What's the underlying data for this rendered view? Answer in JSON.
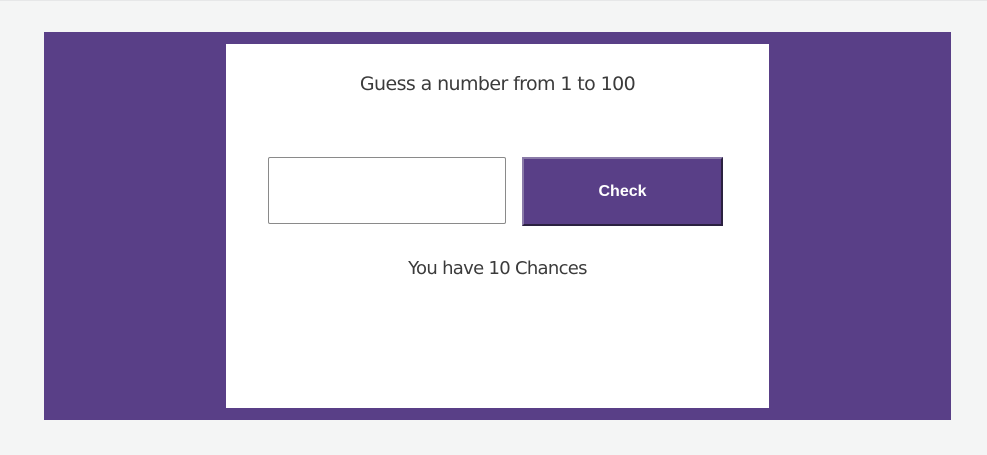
{
  "game": {
    "title": "Guess a number from 1 to 100",
    "input": {
      "value": "",
      "placeholder": ""
    },
    "check_label": "Check",
    "chances_text": "You have 10 Chances"
  },
  "colors": {
    "accent": "#593f87",
    "background": "#f4f5f5",
    "card": "#ffffff",
    "text": "#3b3b3b"
  }
}
